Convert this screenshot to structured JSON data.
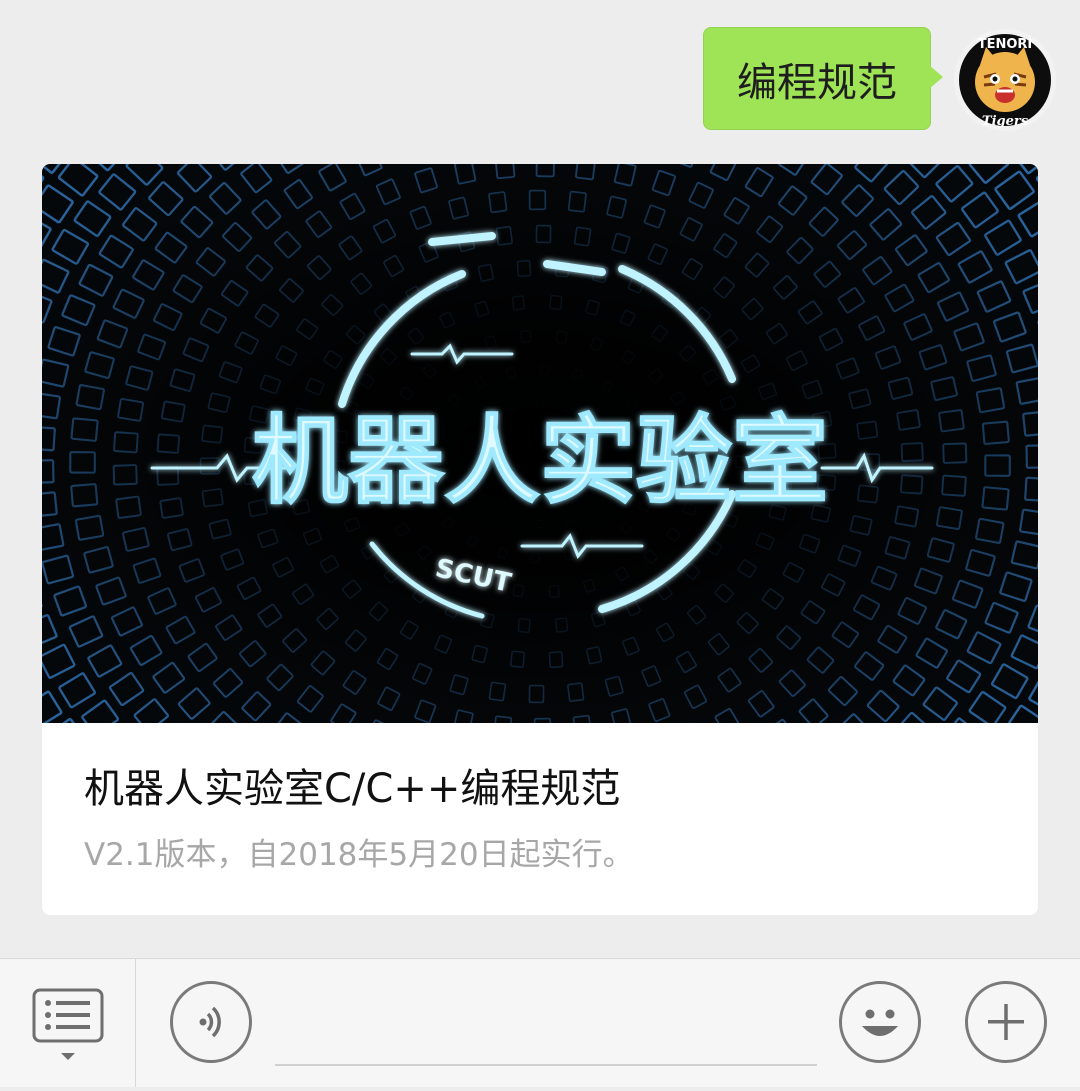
{
  "chat": {
    "message_text": "编程规范",
    "avatar": {
      "text_top": "TENORI",
      "text_bottom": "Tigers",
      "colors": {
        "ring": "#000000",
        "face": "#f0b44c"
      }
    },
    "card": {
      "cover_logo_text": "机器人实验室",
      "cover_logo_subtext": "SCUT",
      "title": "机器人实验室C/C++编程规范",
      "description": "V2.1版本，自2018年5月20日起实行。",
      "colors": {
        "glow": "#8fe8ff",
        "tiles": "#2f6fae"
      }
    }
  },
  "input_bar": {
    "menu_icon": "list-menu-icon",
    "voice_icon": "voice-icon",
    "emoji_icon": "emoji-icon",
    "more_icon": "plus-icon"
  },
  "colors": {
    "bubble": "#9fe457",
    "background": "#ededed",
    "card_desc": "#a7a7a7"
  }
}
